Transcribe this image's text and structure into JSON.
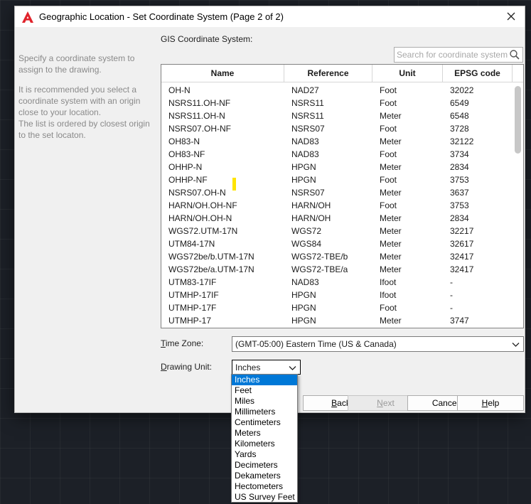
{
  "window": {
    "title": "Geographic Location - Set Coordinate System (Page 2 of 2)"
  },
  "sidebar": {
    "instruction": "Specify a coordinate system to assign to the drawing.",
    "recommendation": "It is recommended you select a coordinate system with an origin close to your location.",
    "ordering": "The list is ordered by closest origin to the set locaton."
  },
  "gis": {
    "label": "GIS Coordinate System:",
    "search_placeholder": "Search for coordinate system"
  },
  "table": {
    "columns": [
      "Name",
      "Reference",
      "Unit",
      "EPSG code"
    ],
    "rows": [
      [
        "OH-N",
        "NAD27",
        "Foot",
        "32022"
      ],
      [
        "NSRS11.OH-NF",
        "NSRS11",
        "Foot",
        "6549"
      ],
      [
        "NSRS11.OH-N",
        "NSRS11",
        "Meter",
        "6548"
      ],
      [
        "NSRS07.OH-NF",
        "NSRS07",
        "Foot",
        "3728"
      ],
      [
        "OH83-N",
        "NAD83",
        "Meter",
        "32122"
      ],
      [
        "OH83-NF",
        "NAD83",
        "Foot",
        "3734"
      ],
      [
        "OHHP-N",
        "HPGN",
        "Meter",
        "2834"
      ],
      [
        "OHHP-NF",
        "HPGN",
        "Foot",
        "3753"
      ],
      [
        "NSRS07.OH-N",
        "NSRS07",
        "Meter",
        "3637"
      ],
      [
        "HARN/OH.OH-NF",
        "HARN/OH",
        "Foot",
        "3753"
      ],
      [
        "HARN/OH.OH-N",
        "HARN/OH",
        "Meter",
        "2834"
      ],
      [
        "WGS72.UTM-17N",
        "WGS72",
        "Meter",
        "32217"
      ],
      [
        "UTM84-17N",
        "WGS84",
        "Meter",
        "32617"
      ],
      [
        "WGS72be/b.UTM-17N",
        "WGS72-TBE/b",
        "Meter",
        "32417"
      ],
      [
        "WGS72be/a.UTM-17N",
        "WGS72-TBE/a",
        "Meter",
        "32417"
      ],
      [
        "UTM83-17IF",
        "NAD83",
        "Ifoot",
        "-"
      ],
      [
        "UTMHP-17IF",
        "HPGN",
        "Ifoot",
        "-"
      ],
      [
        "UTMHP-17F",
        "HPGN",
        "Foot",
        "-"
      ],
      [
        "UTMHP-17",
        "HPGN",
        "Meter",
        "3747"
      ]
    ]
  },
  "time_zone": {
    "label_key": "T",
    "label_rest": "ime Zone:",
    "value": "(GMT-05:00) Eastern Time (US & Canada)"
  },
  "drawing_unit": {
    "label_key": "D",
    "label_rest": "rawing Unit:",
    "value": "Inches",
    "options": [
      "Inches",
      "Feet",
      "Miles",
      "Millimeters",
      "Centimeters",
      "Meters",
      "Kilometers",
      "Yards",
      "Decimeters",
      "Dekameters",
      "Hectometers",
      "US Survey Feet"
    ],
    "selected_index": 0
  },
  "buttons": {
    "back_key": "B",
    "back_rest": "ack",
    "next_key": "N",
    "next_rest": "ext",
    "cancel": "Cancel",
    "help_key": "H",
    "help_rest": "elp"
  },
  "colors": {
    "accent": "#0078d7",
    "logo": "#e0232b",
    "highlight": "#ffe400"
  },
  "icons": {
    "app": "autocad-logo-icon",
    "close": "close-icon",
    "search": "search-icon",
    "dropdown": "chevron-down-icon"
  }
}
